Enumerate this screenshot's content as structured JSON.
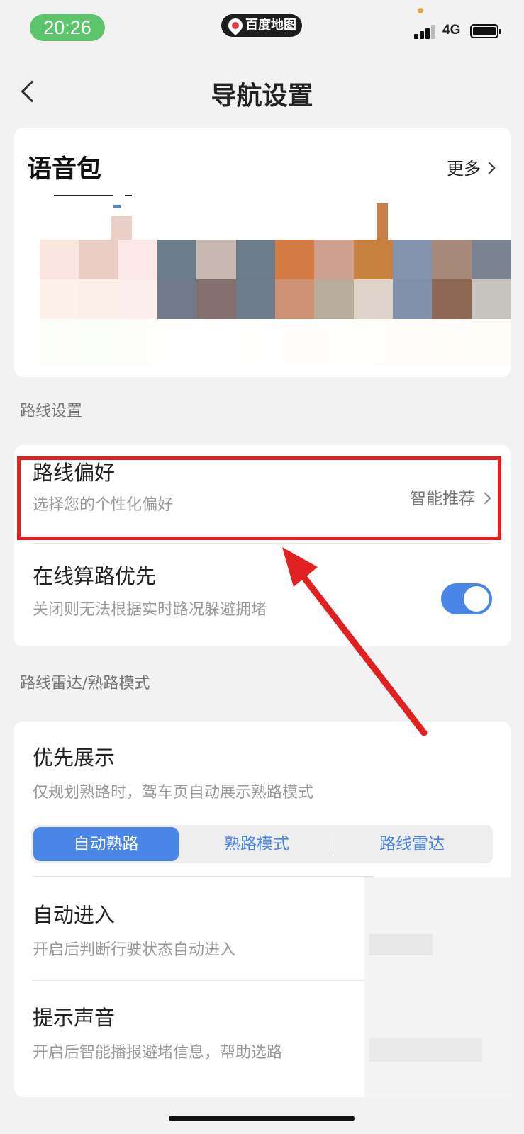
{
  "status_bar": {
    "time": "20:26",
    "app_name": "百度地图",
    "network": "4G",
    "colors": {
      "time_pill": "#5cc46b"
    }
  },
  "nav": {
    "title": "导航设置",
    "back_icon": "chevron-left-icon"
  },
  "voice_pack": {
    "title": "语音包",
    "more_label": "更多"
  },
  "route_section": {
    "label": "路线设置",
    "preference": {
      "title": "路线偏好",
      "subtitle": "选择您的个性化偏好",
      "value": "智能推荐"
    },
    "online_priority": {
      "title": "在线算路优先",
      "subtitle": "关闭则无法根据实时路况躲避拥堵",
      "enabled": true
    }
  },
  "radar_section": {
    "label": "路线雷达/熟路模式",
    "priority_display": {
      "title": "优先展示",
      "subtitle": "仅规划熟路时，驾车页自动展示熟路模式",
      "options": [
        "自动熟路",
        "熟路模式",
        "路线雷达"
      ],
      "selected": "自动熟路"
    },
    "auto_enter": {
      "title": "自动进入",
      "subtitle": "开启后判断行驶状态自动进入"
    },
    "sound": {
      "title": "提示声音",
      "subtitle": "开启后智能播报避堵信息，帮助选路"
    }
  },
  "colors": {
    "accent": "#4a86e8",
    "highlight": "#e12121",
    "annotation_arrow": "#e12121"
  }
}
